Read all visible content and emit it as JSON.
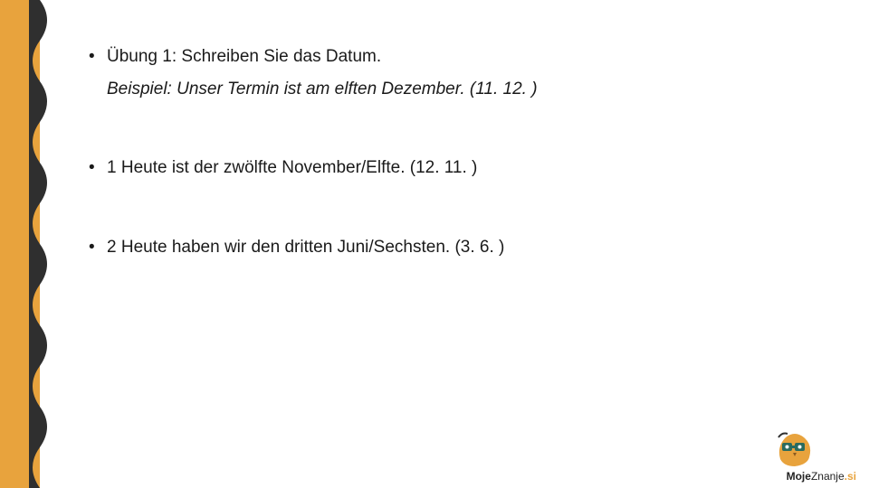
{
  "slide": {
    "lines": [
      {
        "type": "bullet",
        "text": "Übung 1: Schreiben Sie das Datum."
      },
      {
        "type": "italic",
        "text": "Beispiel: Unser Termin ist am elften Dezember. (11. 12. )"
      },
      {
        "type": "spacer"
      },
      {
        "type": "bullet",
        "text": "1 Heute ist der  zwölfte November/Elfte. (12. 11. )"
      },
      {
        "type": "spacer"
      },
      {
        "type": "bullet",
        "text": "2 Heute haben wir den dritten Juni/Sechsten. (3. 6. )"
      }
    ]
  },
  "branding": {
    "name_part1": "Moje",
    "name_part2": "Znanje",
    "tld": ".si",
    "mascot": "owl-mascot-icon"
  },
  "colors": {
    "accent": "#e8a33d",
    "stripe_dark": "#2f2f2f"
  }
}
